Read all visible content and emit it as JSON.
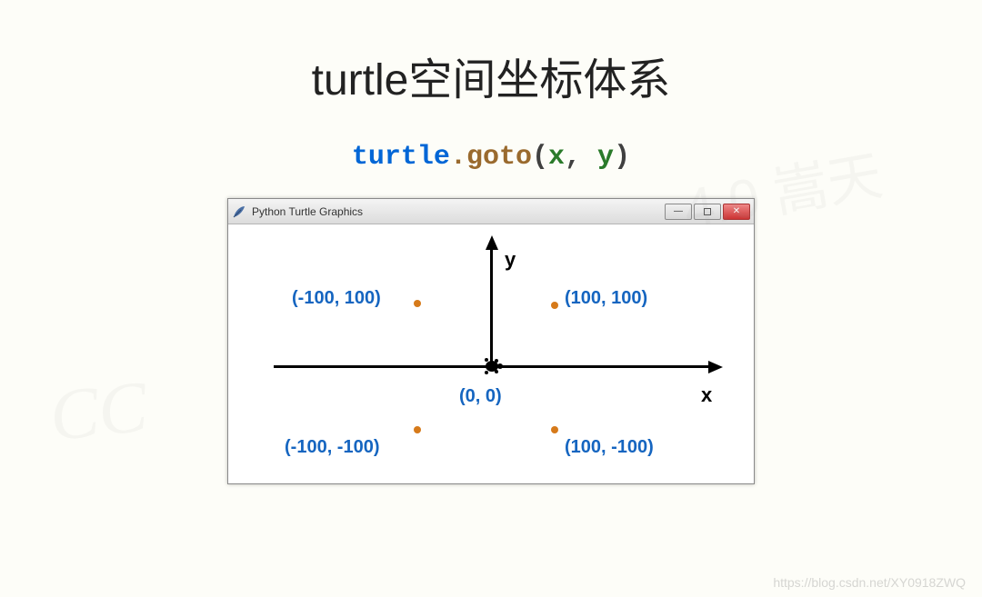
{
  "title": "turtle空间坐标体系",
  "code": {
    "module": "turtle",
    "dot": ".",
    "func": "goto",
    "open": "(",
    "arg1": "x",
    "comma": ",",
    "space": " ",
    "arg2": "y",
    "close": ")"
  },
  "window": {
    "title": "Python Turtle Graphics"
  },
  "axes": {
    "y": "y",
    "x": "x"
  },
  "coords": {
    "origin": "(0, 0)",
    "q2": "(-100, 100)",
    "q1": "(100, 100)",
    "q3": "(-100, -100)",
    "q4": "(100, -100)"
  },
  "watermarks": {
    "cc": "CC",
    "tr": "4.0 嵩天",
    "br": "https://blog.csdn.net/XY0918ZWQ"
  }
}
